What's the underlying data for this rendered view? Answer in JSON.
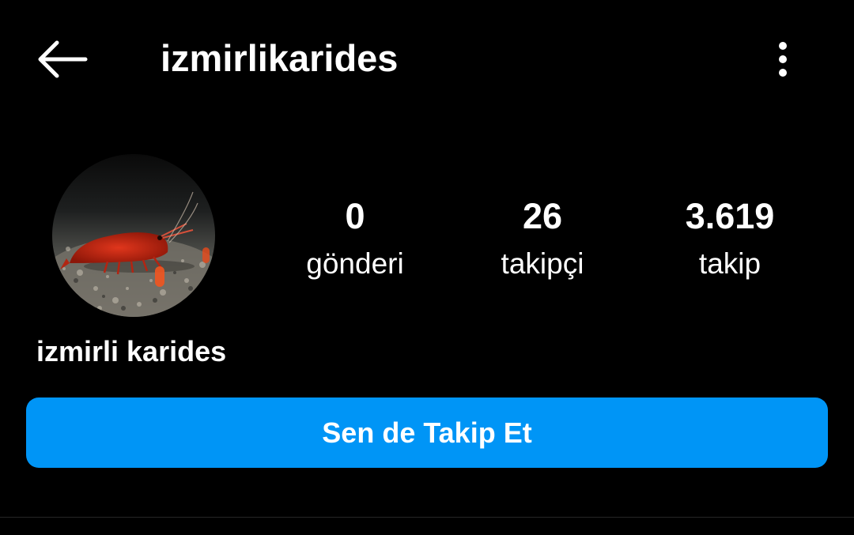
{
  "header": {
    "back_icon": "arrow-left-icon",
    "username": "izmirlikarides",
    "more_icon": "vertical-dots-icon"
  },
  "profile": {
    "avatar_icon": "red-shrimp-photo",
    "display_name": "izmirli karides"
  },
  "stats": [
    {
      "value": "0",
      "label": "gönderi"
    },
    {
      "value": "26",
      "label": "takipçi"
    },
    {
      "value": "3.619",
      "label": "takip"
    }
  ],
  "follow_button": {
    "label": "Sen de Takip Et"
  },
  "colors": {
    "background": "#000000",
    "text": "#ffffff",
    "accent": "#0095f6",
    "divider": "#262626"
  }
}
